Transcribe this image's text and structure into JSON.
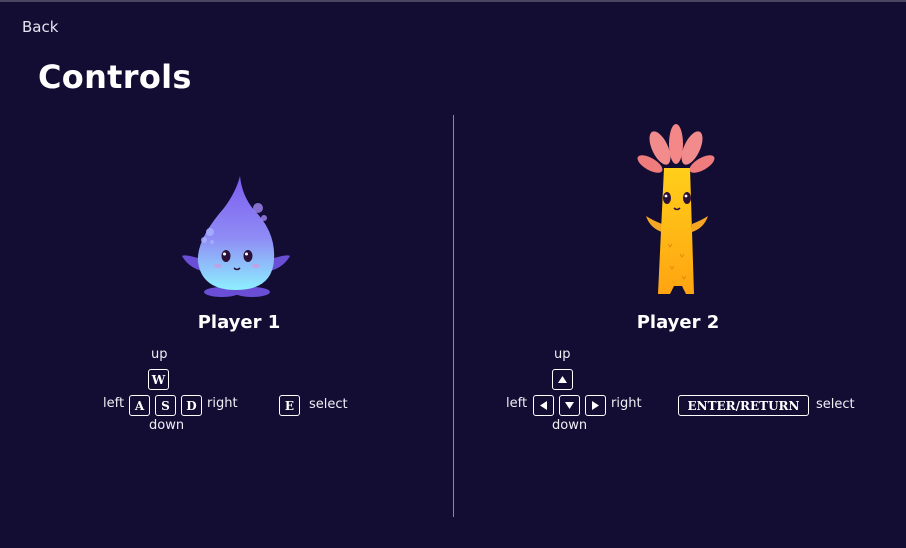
{
  "header": {
    "back_label": "Back",
    "title": "Controls"
  },
  "player1": {
    "name": "Player 1",
    "character_icon": "water-drop-character",
    "labels": {
      "up": "up",
      "left": "left",
      "right": "right",
      "down": "down",
      "select": "select"
    },
    "keys": {
      "up": "W",
      "left": "A",
      "down": "S",
      "right": "D",
      "select": "E"
    }
  },
  "player2": {
    "name": "Player 2",
    "character_icon": "palm-tree-character",
    "labels": {
      "up": "up",
      "left": "left",
      "right": "right",
      "down": "down",
      "select": "select"
    },
    "keys": {
      "up": "arrow-up-icon",
      "left": "arrow-left-icon",
      "down": "arrow-down-icon",
      "right": "arrow-right-icon",
      "select": "ENTER/RETURN"
    }
  },
  "colors": {
    "background": "#130d33",
    "text": "#ffffff",
    "divider": "#8a87a0"
  }
}
